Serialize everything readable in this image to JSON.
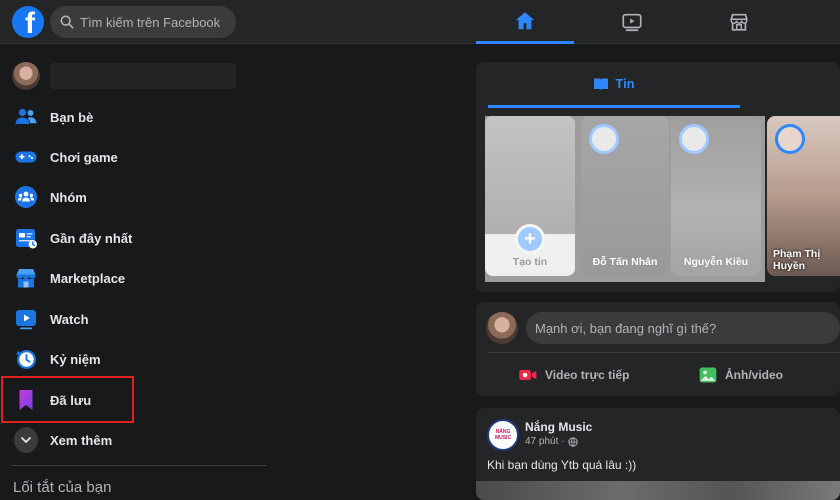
{
  "colors": {
    "accent": "#2d88ff",
    "background": "#18191a",
    "surface": "#242526",
    "highlight": "#e0221d"
  },
  "topbar": {
    "logo_letter": "f",
    "search_placeholder": "Tìm kiếm trên Facebook",
    "nav_tabs": [
      {
        "icon": "home-icon",
        "active": true
      },
      {
        "icon": "watch-video-icon",
        "active": false
      },
      {
        "icon": "marketplace-store-icon",
        "active": false
      }
    ]
  },
  "sidebar": {
    "items": [
      {
        "label": "Bạn bè",
        "icon": "friends-icon"
      },
      {
        "label": "Chơi game",
        "icon": "gaming-controller-icon"
      },
      {
        "label": "Nhóm",
        "icon": "groups-icon"
      },
      {
        "label": "Gần đây nhất",
        "icon": "most-recent-icon"
      },
      {
        "label": "Marketplace",
        "icon": "marketplace-icon"
      },
      {
        "label": "Watch",
        "icon": "watch-icon"
      },
      {
        "label": "Kỷ niệm",
        "icon": "memories-clock-icon"
      },
      {
        "label": "Đã lưu",
        "icon": "saved-bookmark-icon"
      },
      {
        "label": "Xem thêm",
        "icon": "chevron-down-icon"
      }
    ],
    "shortcuts_title": "Lối tắt của bạn"
  },
  "stories": {
    "tab_label": "Tin",
    "cards": [
      {
        "caption": "Tạo tin"
      },
      {
        "caption": "Đỗ Tấn Nhân"
      },
      {
        "caption": "Nguyễn Kiều"
      },
      {
        "caption": "Phạm Thị Huyền"
      }
    ]
  },
  "composer": {
    "placeholder": "Mạnh ơi, bạn đang nghĩ gì thế?",
    "actions": [
      {
        "label": "Video trực tiếp",
        "icon": "live-video-icon"
      },
      {
        "label": "Ảnh/video",
        "icon": "photo-video-icon"
      }
    ]
  },
  "post": {
    "author": "Nắng Music",
    "avatar_text": "NẮNG MUSIC",
    "time": "47 phút",
    "text": "Khi bạn dùng Ytb quá lâu :))"
  }
}
